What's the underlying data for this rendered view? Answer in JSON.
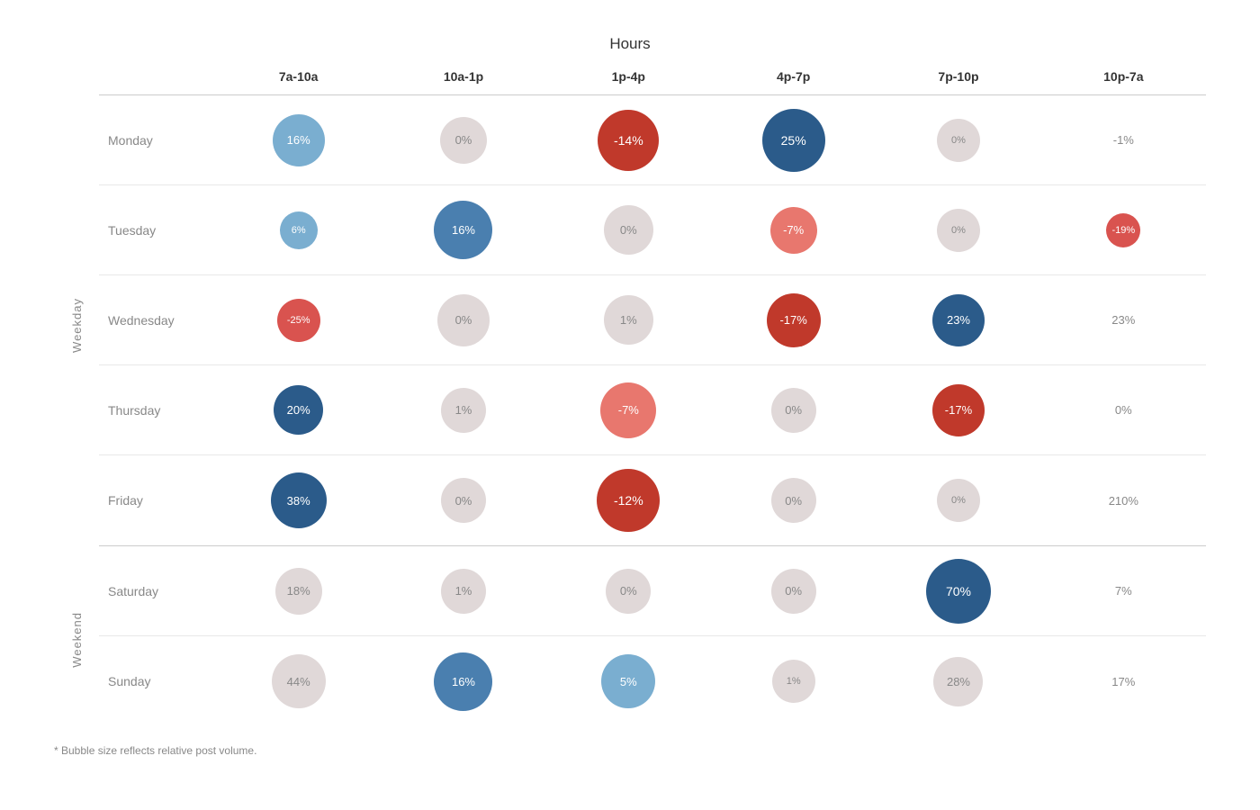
{
  "title": "Hours",
  "columns": [
    "7a-10a",
    "10a-1p",
    "1p-4p",
    "4p-7p",
    "7p-10p",
    "10p-7a"
  ],
  "group_weekday_label": "Weekday",
  "group_weekend_label": "Weekend",
  "footnote": "* Bubble size reflects relative post volume.",
  "rows": [
    {
      "day": "Monday",
      "group": "weekday",
      "cells": [
        {
          "value": "16%",
          "style": "blue-light",
          "size": 58
        },
        {
          "value": "0%",
          "style": "neutral",
          "size": 52
        },
        {
          "value": "-14%",
          "style": "red-dark",
          "size": 68
        },
        {
          "value": "25%",
          "style": "blue-dark",
          "size": 70
        },
        {
          "value": "0%",
          "style": "neutral",
          "size": 48
        },
        {
          "value": "-1%",
          "style": "plain",
          "size": 0
        }
      ]
    },
    {
      "day": "Tuesday",
      "group": "weekday",
      "cells": [
        {
          "value": "6%",
          "style": "blue-light",
          "size": 42
        },
        {
          "value": "16%",
          "style": "blue-mid",
          "size": 65
        },
        {
          "value": "0%",
          "style": "neutral",
          "size": 55
        },
        {
          "value": "-7%",
          "style": "salmon",
          "size": 52
        },
        {
          "value": "0%",
          "style": "neutral",
          "size": 48
        },
        {
          "value": "-19%",
          "style": "red-mid",
          "size": 38
        }
      ]
    },
    {
      "day": "Wednesday",
      "group": "weekday",
      "cells": [
        {
          "value": "-25%",
          "style": "red-mid",
          "size": 48
        },
        {
          "value": "0%",
          "style": "neutral",
          "size": 58
        },
        {
          "value": "1%",
          "style": "neutral",
          "size": 55
        },
        {
          "value": "-17%",
          "style": "red-dark",
          "size": 60
        },
        {
          "value": "23%",
          "style": "blue-dark",
          "size": 58
        },
        {
          "value": "23%",
          "style": "plain",
          "size": 0
        }
      ]
    },
    {
      "day": "Thursday",
      "group": "weekday",
      "cells": [
        {
          "value": "20%",
          "style": "blue-dark",
          "size": 55
        },
        {
          "value": "1%",
          "style": "neutral",
          "size": 50
        },
        {
          "value": "-7%",
          "style": "salmon",
          "size": 62
        },
        {
          "value": "0%",
          "style": "neutral",
          "size": 50
        },
        {
          "value": "-17%",
          "style": "red-dark",
          "size": 58
        },
        {
          "value": "0%",
          "style": "plain",
          "size": 0
        }
      ]
    },
    {
      "day": "Friday",
      "group": "weekday",
      "cells": [
        {
          "value": "38%",
          "style": "blue-dark",
          "size": 62
        },
        {
          "value": "0%",
          "style": "neutral",
          "size": 50
        },
        {
          "value": "-12%",
          "style": "red-dark",
          "size": 70
        },
        {
          "value": "0%",
          "style": "neutral",
          "size": 50
        },
        {
          "value": "0%",
          "style": "neutral",
          "size": 48
        },
        {
          "value": "210%",
          "style": "plain",
          "size": 0
        }
      ]
    },
    {
      "day": "Saturday",
      "group": "weekend",
      "cells": [
        {
          "value": "18%",
          "style": "neutral",
          "size": 52
        },
        {
          "value": "1%",
          "style": "neutral",
          "size": 50
        },
        {
          "value": "0%",
          "style": "neutral",
          "size": 50
        },
        {
          "value": "0%",
          "style": "neutral",
          "size": 50
        },
        {
          "value": "70%",
          "style": "blue-dark",
          "size": 72
        },
        {
          "value": "7%",
          "style": "plain",
          "size": 0
        }
      ]
    },
    {
      "day": "Sunday",
      "group": "weekend",
      "cells": [
        {
          "value": "44%",
          "style": "neutral",
          "size": 60
        },
        {
          "value": "16%",
          "style": "blue-mid",
          "size": 65
        },
        {
          "value": "5%",
          "style": "blue-light",
          "size": 60
        },
        {
          "value": "1%",
          "style": "neutral",
          "size": 48
        },
        {
          "value": "28%",
          "style": "neutral",
          "size": 55
        },
        {
          "value": "17%",
          "style": "plain",
          "size": 0
        }
      ]
    }
  ]
}
